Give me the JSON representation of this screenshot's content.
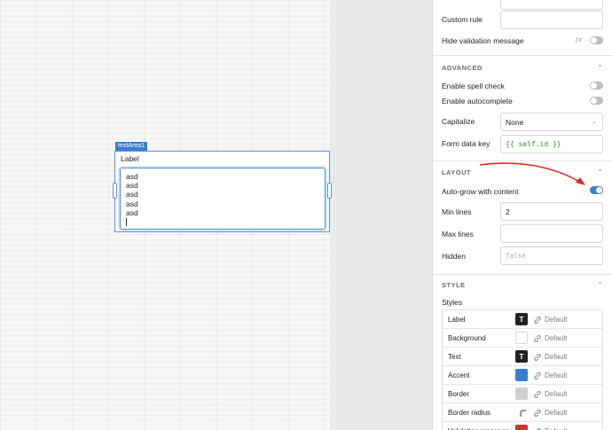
{
  "canvas": {
    "widget_tag": "textArea1",
    "widget_label": "Label",
    "textarea_lines": [
      "asd",
      "asd",
      "asd",
      "asd",
      "asd"
    ]
  },
  "panel": {
    "top_rows": [
      {
        "label": "Custom rule"
      },
      {
        "label": "Hide validation message"
      }
    ],
    "advanced": {
      "title": "ADVANCED",
      "spell_check": "Enable spell check",
      "autocomplete": "Enable autocomplete",
      "capitalize_label": "Capitalize",
      "capitalize_value": "None",
      "form_key_label": "Form data key",
      "form_key_value": "{{ self.id }}"
    },
    "layout": {
      "title": "LAYOUT",
      "autogrow": "Auto-grow with content",
      "min_lines_label": "Min lines",
      "min_lines_value": "2",
      "max_lines_label": "Max lines",
      "hidden_label": "Hidden",
      "hidden_placeholder": "false"
    },
    "style": {
      "title": "STYLE",
      "styles_label": "Styles",
      "rows": [
        {
          "name": "Label",
          "color": "#222222",
          "glyph": "T",
          "default": "Default"
        },
        {
          "name": "Background",
          "color": "#ffffff",
          "glyph": "",
          "default": "Default"
        },
        {
          "name": "Text",
          "color": "#222222",
          "glyph": "T",
          "default": "Default"
        },
        {
          "name": "Accent",
          "color": "#3b7fd1",
          "glyph": "",
          "default": "Default"
        },
        {
          "name": "Border",
          "color": "#cfcfcf",
          "glyph": "",
          "default": "Default"
        },
        {
          "name": "Border radius",
          "color": "",
          "glyph": "",
          "default": "Default"
        },
        {
          "name": "Validation message",
          "color": "#c0392b",
          "glyph": "",
          "default": "Default"
        }
      ]
    }
  },
  "colors": {
    "accent": "#3b7fd1",
    "annotation_arrow": "#e02a1b"
  }
}
